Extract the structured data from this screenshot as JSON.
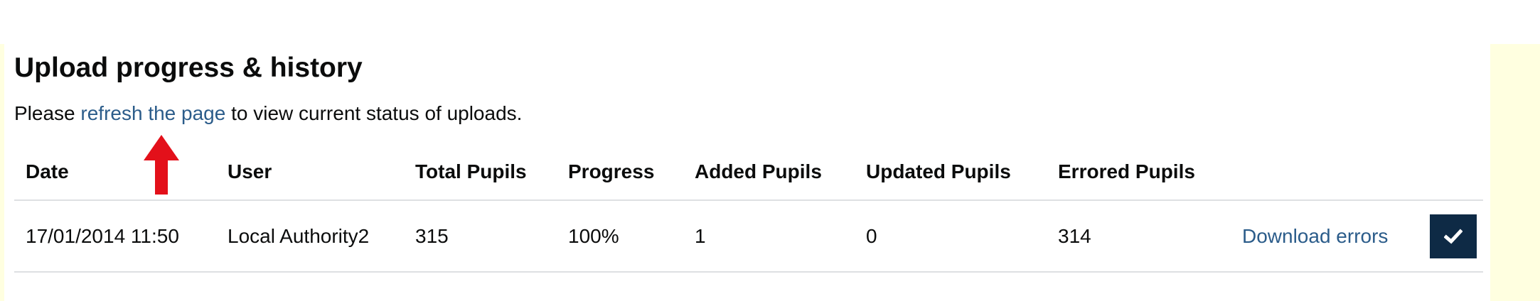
{
  "heading": "Upload progress & history",
  "intro": {
    "before": "Please ",
    "link": "refresh the page",
    "after": " to view current status of uploads."
  },
  "table": {
    "headers": {
      "date": "Date",
      "user": "User",
      "total": "Total Pupils",
      "progress": "Progress",
      "added": "Added Pupils",
      "updated": "Updated Pupils",
      "errored": "Errored Pupils"
    },
    "rows": [
      {
        "date": "17/01/2014 11:50",
        "user": "Local Authority2",
        "total": "315",
        "progress": "100%",
        "added": "1",
        "updated": "0",
        "errored": "314",
        "action_link": "Download errors",
        "status_icon": "checkmark-icon"
      }
    ]
  },
  "colors": {
    "link": "#2b5c8a",
    "status_button": "#0e2a45",
    "annotation_arrow": "#e3101a",
    "background_band": "#ffffe0"
  }
}
